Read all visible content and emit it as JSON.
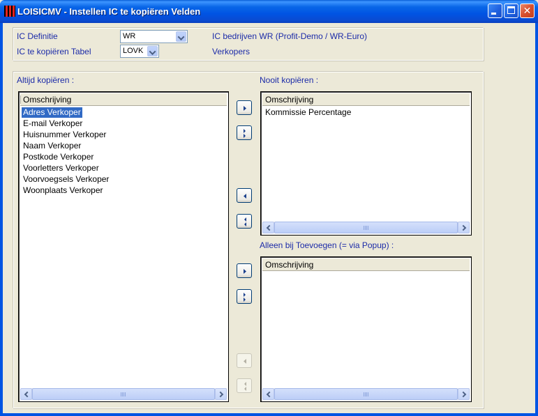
{
  "window": {
    "title": "LOISICMV - Instellen IC te kopiëren Velden"
  },
  "top": {
    "ic_definitie_label": "IC Definitie",
    "ic_definitie_value": "WR",
    "tabel_label": "IC te kopiëren Tabel",
    "tabel_value": "LOVK",
    "bedrijven_text": "IC bedrijven WR (Profit-Demo / WR-Euro)",
    "tabel_description": "Verkopers"
  },
  "left_list": {
    "title": "Altijd kopiëren :",
    "header": "Omschrijving",
    "items": [
      {
        "label": "Adres Verkoper",
        "selected": true
      },
      {
        "label": "E-mail Verkoper",
        "selected": false
      },
      {
        "label": "Huisnummer Verkoper",
        "selected": false
      },
      {
        "label": "Naam Verkoper",
        "selected": false
      },
      {
        "label": "Postkode Verkoper",
        "selected": false
      },
      {
        "label": "Voorletters Verkoper",
        "selected": false
      },
      {
        "label": "Voorvoegsels Verkoper",
        "selected": false
      },
      {
        "label": "Woonplaats Verkoper",
        "selected": false
      }
    ]
  },
  "right_top_list": {
    "title": "Nooit kopiëren :",
    "header": "Omschrijving",
    "items": [
      {
        "label": "Kommissie Percentage",
        "selected": false
      }
    ]
  },
  "right_bottom_list": {
    "title": "Alleen bij Toevoegen (= via Popup) :",
    "header": "Omschrijving",
    "items": []
  },
  "scrollbar": {
    "thumb_glyph": "III"
  },
  "colors": {
    "titlebar": "#0054e3",
    "label_text": "#1c2ba8",
    "selection": "#316ac5",
    "face": "#ece9d8"
  }
}
